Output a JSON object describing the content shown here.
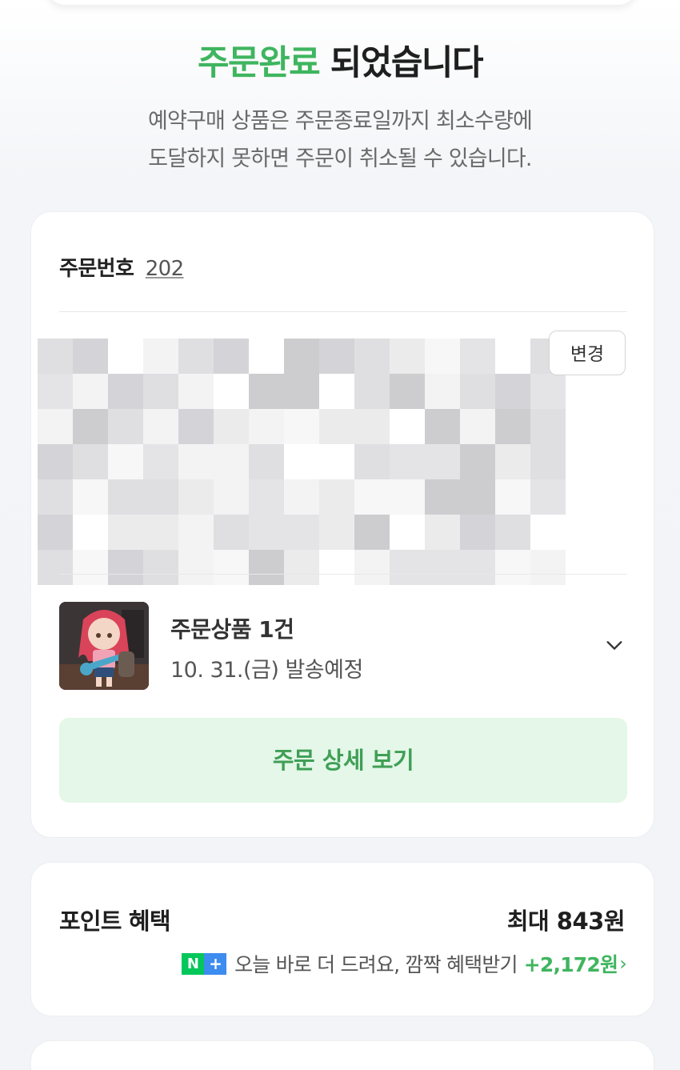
{
  "headline": {
    "accent": "주문완료",
    "rest": " 되었습니다"
  },
  "notice": {
    "line1": "예약구매 상품은 주문종료일까지 최소수량에",
    "line2": "도달하지 못하면 주문이 취소될 수 있습니다."
  },
  "order": {
    "number_label": "주문번호",
    "number_value_visible": "202",
    "change_label": "변경",
    "product_count": "주문상품 1건",
    "ship_date": "10. 31.(금) 발송예정",
    "detail_button": "주문 상세 보기"
  },
  "points": {
    "title": "포인트 혜택",
    "max": "최대 843원",
    "promo_text": "오늘 바로 더 드려요, 깜짝 혜택받기",
    "promo_amount": "+2,172원"
  },
  "icons": {
    "expand": "chevron-down-icon",
    "promo_arrow": "chevron-right-icon",
    "badge": "naver-plus-icon"
  },
  "colors": {
    "accent_green": "#3fb55f",
    "button_bg": "#e4f7e8",
    "button_text": "#3f9f56"
  }
}
